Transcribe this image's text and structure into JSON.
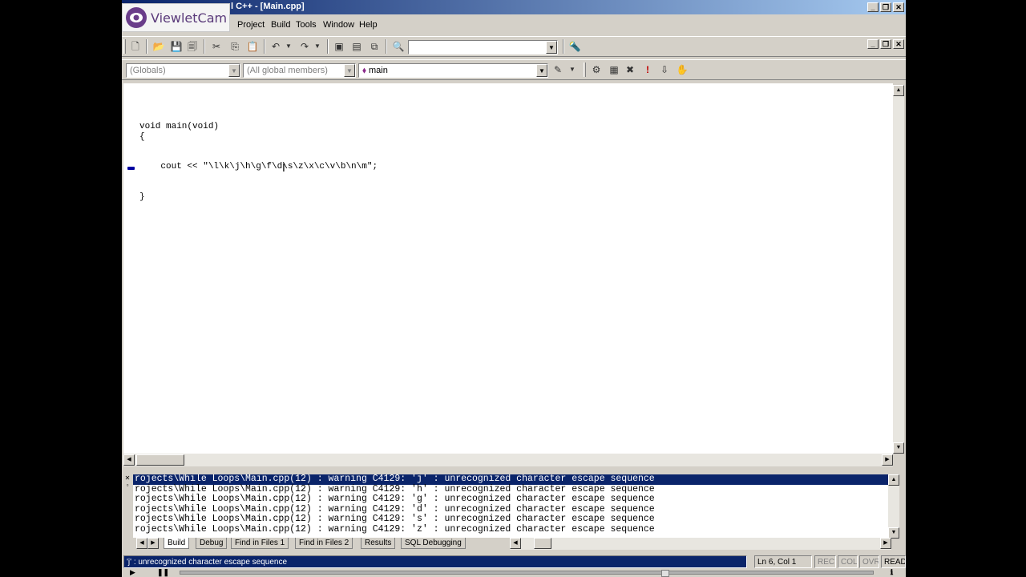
{
  "window": {
    "title": "l C++ - [Main.cpp]"
  },
  "watermark": {
    "brand": "ViewletCam"
  },
  "menu": {
    "items": [
      {
        "label": "Project",
        "hotkey": "P"
      },
      {
        "label": "Build",
        "hotkey": "B"
      },
      {
        "label": "Tools",
        "hotkey": "T"
      },
      {
        "label": "Window",
        "hotkey": "W"
      },
      {
        "label": "Help",
        "hotkey": "H"
      }
    ]
  },
  "toolbar": {
    "find_combo_value": "",
    "scope_combo": "(Globals)",
    "members_combo": "(All global members)",
    "function_combo": "main"
  },
  "editor": {
    "code_lines": [
      "void main(void)",
      "{",
      "",
      "",
      "    cout << \"\\l\\k\\j\\h\\g\\f\\d\\s\\z\\x\\c\\v\\b\\n\\m\";",
      "",
      "",
      "}"
    ]
  },
  "output": {
    "lines": [
      "rojects\\While Loops\\Main.cpp(12) : warning C4129: 'j' : unrecognized character escape sequence",
      "rojects\\While Loops\\Main.cpp(12) : warning C4129: 'h' : unrecognized character escape sequence",
      "rojects\\While Loops\\Main.cpp(12) : warning C4129: 'g' : unrecognized character escape sequence",
      "rojects\\While Loops\\Main.cpp(12) : warning C4129: 'd' : unrecognized character escape sequence",
      "rojects\\While Loops\\Main.cpp(12) : warning C4129: 's' : unrecognized character escape sequence",
      "rojects\\While Loops\\Main.cpp(12) : warning C4129: 'z' : unrecognized character escape sequence"
    ],
    "selected_index": 0,
    "tabs": [
      "Build",
      "Debug",
      "Find in Files 1",
      "Find in Files 2",
      "Results",
      "SQL Debugging"
    ],
    "active_tab": 0
  },
  "status": {
    "message": "'j' : unrecognized character escape sequence",
    "position": "Ln 6, Col 1",
    "rec": "REC",
    "col": "COL",
    "ovr": "OVR",
    "read": "READ"
  },
  "colors": {
    "titlebar_start": "#0a246a",
    "titlebar_end": "#a6caf0",
    "selection": "#0a246a",
    "face": "#d4d0c8"
  }
}
